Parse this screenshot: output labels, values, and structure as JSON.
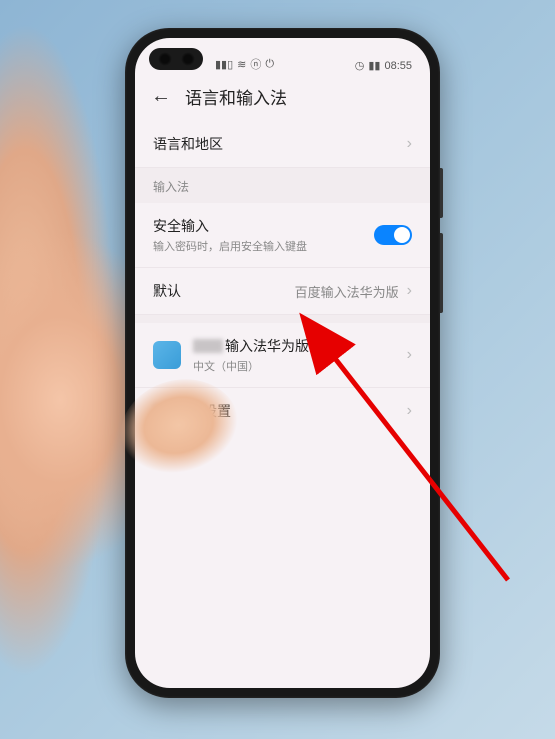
{
  "status_bar": {
    "signal_icon": "▮▮▯",
    "wifi_icon": "≋",
    "battery_icon": "⏻",
    "nfc": "ⓝ",
    "misc": "◷",
    "battery_text": "▮▮",
    "time": "08:55"
  },
  "header": {
    "title": "语言和输入法"
  },
  "rows": {
    "language_region": "语言和地区",
    "input_method_section": "输入法",
    "secure_input_title": "安全输入",
    "secure_input_sub": "输入密码时，启用安全输入键盘",
    "default_label": "默认",
    "default_value": "百度输入法华为版",
    "ime_title_suffix": "输入法华为版",
    "ime_sub": "中文（中国）",
    "more_settings_suffix": "入法设置"
  }
}
